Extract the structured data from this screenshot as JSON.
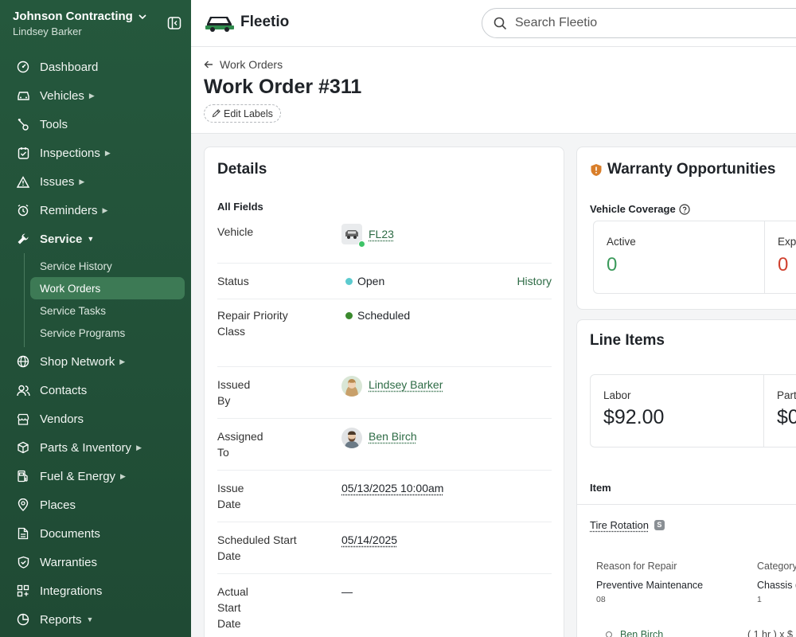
{
  "org": {
    "name": "Johnson Contracting",
    "user": "Lindsey Barker"
  },
  "nav": [
    {
      "label": "Dashboard",
      "icon": "dashboard-icon",
      "caret": ""
    },
    {
      "label": "Vehicles",
      "icon": "car-icon",
      "caret": "▶"
    },
    {
      "label": "Tools",
      "icon": "tools-icon",
      "caret": ""
    },
    {
      "label": "Inspections",
      "icon": "clipboard-icon",
      "caret": "▶"
    },
    {
      "label": "Issues",
      "icon": "warning-icon",
      "caret": "▶"
    },
    {
      "label": "Reminders",
      "icon": "alarm-icon",
      "caret": "▶"
    },
    {
      "label": "Service",
      "icon": "wrench-icon",
      "caret": "▼"
    }
  ],
  "service_sub": [
    "Service History",
    "Work Orders",
    "Service Tasks",
    "Service Programs"
  ],
  "nav2": [
    {
      "label": "Shop Network",
      "icon": "globe-icon",
      "caret": "▶"
    },
    {
      "label": "Contacts",
      "icon": "contacts-icon",
      "caret": ""
    },
    {
      "label": "Vendors",
      "icon": "store-icon",
      "caret": ""
    },
    {
      "label": "Parts & Inventory",
      "icon": "box-icon",
      "caret": "▶"
    },
    {
      "label": "Fuel & Energy",
      "icon": "fuel-icon",
      "caret": "▶"
    },
    {
      "label": "Places",
      "icon": "pin-icon",
      "caret": ""
    },
    {
      "label": "Documents",
      "icon": "document-icon",
      "caret": ""
    },
    {
      "label": "Warranties",
      "icon": "shield-check-icon",
      "caret": ""
    },
    {
      "label": "Integrations",
      "icon": "grid-plus-icon",
      "caret": ""
    },
    {
      "label": "Reports",
      "icon": "chart-pie-icon",
      "caret": "▼"
    }
  ],
  "brand": "Fleetio",
  "search": {
    "placeholder": "Search Fleetio"
  },
  "breadcrumb": "Work Orders",
  "title": "Work Order #311",
  "edit_labels": "Edit Labels",
  "details": {
    "title": "Details",
    "section": "All Fields",
    "vehicle_label": "Vehicle",
    "vehicle_value": "FL23",
    "status_label": "Status",
    "status_value": "Open",
    "history": "History",
    "priority_label": "Repair Priority Class",
    "priority_value": "Scheduled",
    "issued_label": "Issued By",
    "issued_value": "Lindsey Barker",
    "assigned_label": "Assigned To",
    "assigned_value": "Ben Birch",
    "issue_date_label": "Issue Date",
    "issue_date_value": "05/13/2025 10:00am",
    "sched_label": "Scheduled Start Date",
    "sched_value": "05/14/2025",
    "actual_label": "Actual Start Date",
    "actual_value": "—"
  },
  "warranty": {
    "title": "Warranty Opportunities",
    "coverage_label": "Vehicle Coverage",
    "active_label": "Active",
    "active_value": "0",
    "expired_label": "Exp",
    "expired_value": "0"
  },
  "line_items": {
    "title": "Line Items",
    "labor_label": "Labor",
    "labor_value": "$92.00",
    "parts_label": "Part",
    "parts_value": "$0",
    "column_item": "Item",
    "item_name": "Tire Rotation",
    "item_badge": "S",
    "reason_header": "Reason for Repair",
    "reason_value": "Preventive Maintenance",
    "reason_code": "08",
    "category_header": "Category",
    "category_value": "Chassis (",
    "category_code": "1",
    "assignee": "Ben Birch",
    "rate": "( 1 hr ) x $"
  },
  "colors": {
    "sidebar": "#25583d",
    "accent": "#2d6b45",
    "open": "#5ccbcf",
    "scheduled": "#3b8a2e",
    "expired": "#d0402e",
    "active": "#3b9a5b"
  }
}
